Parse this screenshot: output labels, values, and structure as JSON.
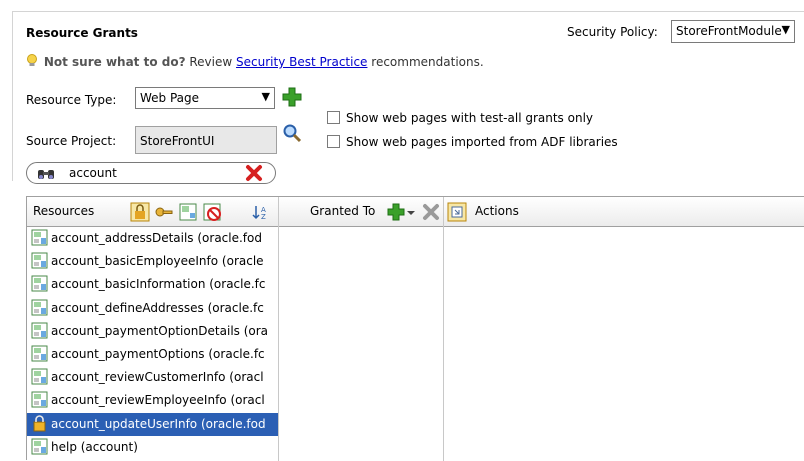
{
  "header": {
    "title": "Resource Grants",
    "security_policy_label": "Security Policy:",
    "security_policy_value": "StoreFrontModule"
  },
  "hint": {
    "bold": "Not sure what to do?",
    "before_link": "Review",
    "link": "Security Best Practice",
    "after_link": "recommendations."
  },
  "resource_type": {
    "label": "Resource Type:",
    "value": "Web Page"
  },
  "source_project": {
    "label": "Source Project:",
    "value": "StoreFrontUI"
  },
  "options": {
    "test_all": "Show web pages with test-all grants only",
    "adf_libs": "Show web pages imported from ADF libraries"
  },
  "filter": {
    "value": "account"
  },
  "table": {
    "col_resources": "Resources",
    "col_granted_to": "Granted To",
    "col_actions": "Actions",
    "rows": [
      {
        "label": "account_addressDetails (oracle.fod",
        "icon": "page-icon",
        "selected": false
      },
      {
        "label": "account_basicEmployeeInfo (oracle",
        "icon": "page-icon",
        "selected": false
      },
      {
        "label": "account_basicInformation (oracle.fc",
        "icon": "page-icon",
        "selected": false
      },
      {
        "label": "account_defineAddresses (oracle.fc",
        "icon": "page-icon",
        "selected": false
      },
      {
        "label": "account_paymentOptionDetails (ora",
        "icon": "page-icon",
        "selected": false
      },
      {
        "label": "account_paymentOptions (oracle.fc",
        "icon": "page-icon",
        "selected": false
      },
      {
        "label": "account_reviewCustomerInfo (oracl",
        "icon": "page-icon",
        "selected": false
      },
      {
        "label": "account_reviewEmployeeInfo (oracl",
        "icon": "page-icon",
        "selected": false
      },
      {
        "label": "account_updateUserInfo (oracle.fod",
        "icon": "lock-icon",
        "selected": true
      },
      {
        "label": "help (account)",
        "icon": "page-icon",
        "selected": false
      }
    ]
  },
  "colors": {
    "selection": "#2b5fb4",
    "link": "#0000cc",
    "add_green": "#3aa02a",
    "delete_red": "#d62020"
  }
}
